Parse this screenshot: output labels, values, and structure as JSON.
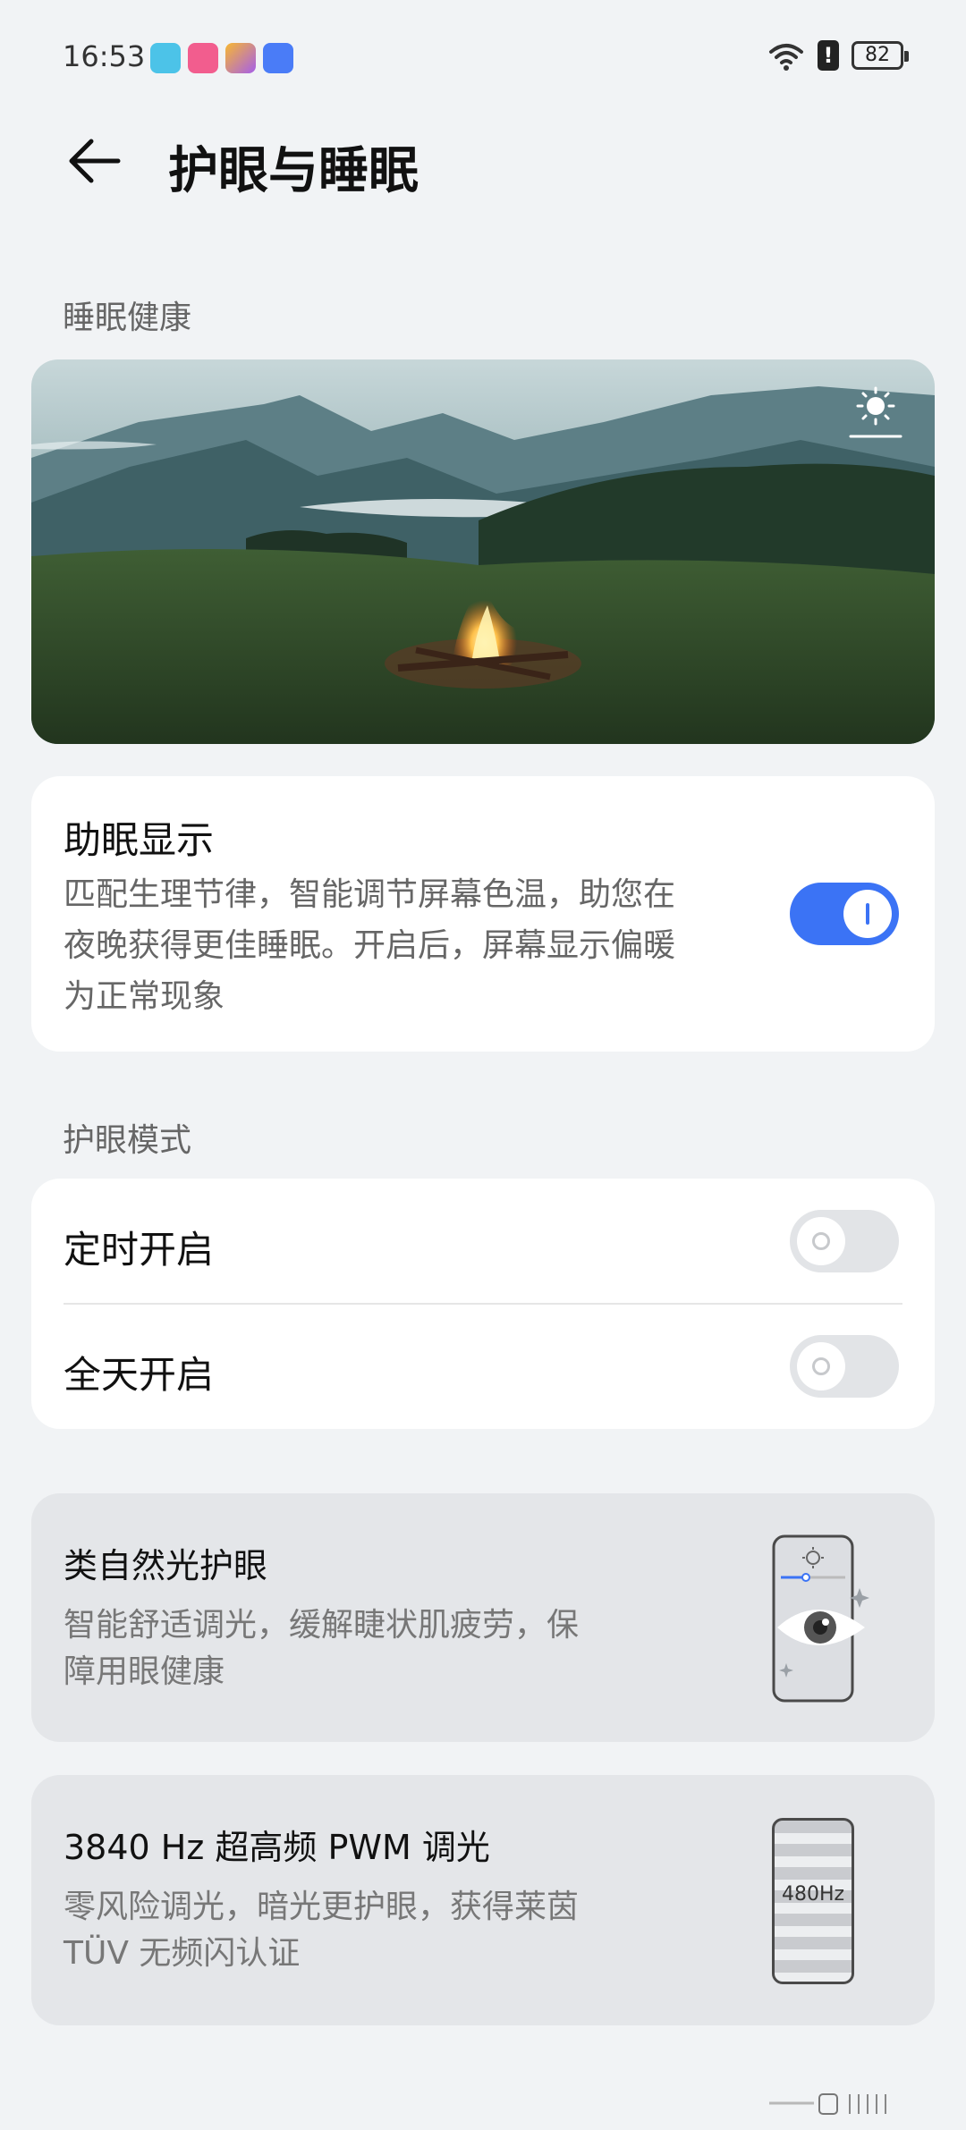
{
  "status_bar": {
    "time": "16:53",
    "battery": "82",
    "alert": "!",
    "icons": [
      "book-app-icon",
      "bilibili-app-icon",
      "gallery-app-icon",
      "store-app-icon",
      "wifi-icon",
      "alert-icon",
      "battery-icon"
    ]
  },
  "header": {
    "title": "护眼与睡眠"
  },
  "sections": {
    "sleep_health": "睡眠健康",
    "eye_mode": "护眼模式"
  },
  "sleep_display": {
    "title": "助眠显示",
    "desc_lines": [
      "匹配生理节律，智能调节屏幕色温，助您在",
      "夜晚获得更佳睡眠。开启后，屏幕显示偏暖",
      "为正常现象"
    ],
    "enabled": true
  },
  "eye_mode_rows": [
    {
      "label": "定时开启",
      "enabled": false
    },
    {
      "label": "全天开启",
      "enabled": false
    }
  ],
  "features": [
    {
      "title": "类自然光护眼",
      "desc_lines": [
        "智能舒适调光，缓解睫状肌疲劳，保",
        "障用眼健康"
      ]
    },
    {
      "title": "3840 Hz 超高频 PWM 调光",
      "desc_lines": [
        "零风险调光，暗光更护眼，获得莱茵",
        "TÜV 无频闪认证"
      ],
      "illus_label": "480Hz"
    }
  ],
  "colors": {
    "accent": "#3b73f5",
    "background": "#f1f3f5"
  }
}
